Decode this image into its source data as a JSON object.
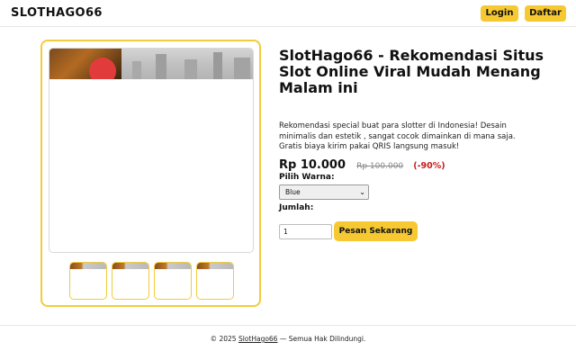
{
  "header": {
    "brand": "SLOTHAGO66",
    "login_label": "Login",
    "register_label": "Daftar"
  },
  "product": {
    "title": "SlotHago66 - Rekomendasi Situs Slot Online Viral Mudah Menang Malam ini",
    "description": "Rekomendasi special buat para slotter di Indonesia! Desain minimalis dan estetik , sangat cocok dimainkan di mana saja. Gratis biaya kirim pakai QRIS langsung masuk!",
    "price": "Rp 10.000",
    "old_price": "Rp 100.000",
    "discount": "(-90%)",
    "color_label": "Pilih Warna:",
    "color_selected": "Blue",
    "qty_label": "Jumlah:",
    "qty_value": "1",
    "buy_label": "Pesan Sekarang"
  },
  "gallery": {
    "thumbnail_count": 4
  },
  "footer": {
    "prefix": "© 2025 ",
    "link": "SlotHago66",
    "suffix": " — Semua Hak Dilindungi."
  },
  "colors": {
    "accent": "#f6c932",
    "card_border": "#f2cc3b",
    "discount": "#c51d1d"
  }
}
